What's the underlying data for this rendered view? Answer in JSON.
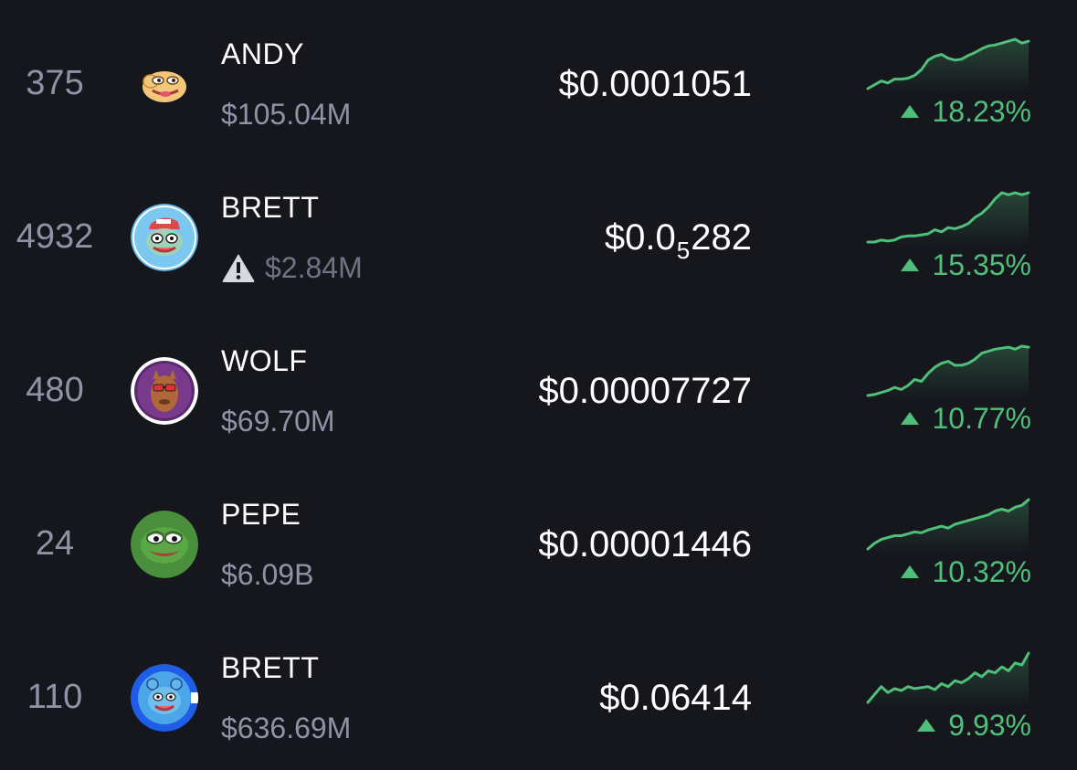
{
  "colors": {
    "background": "#16171d",
    "text_primary": "#ffffff",
    "text_secondary": "#8f93a6",
    "positive": "#4fbf7a"
  },
  "tokens": [
    {
      "rank": "375",
      "name": "ANDY",
      "market_cap": "$105.04M",
      "warning": false,
      "price_parts": [
        "$0.0001051"
      ],
      "change": "18.23%",
      "sparkline": [
        10,
        14,
        18,
        16,
        20,
        20,
        21,
        24,
        30,
        40,
        44,
        46,
        42,
        40,
        41,
        45,
        48,
        52,
        55,
        56,
        58,
        60,
        62,
        58,
        60
      ],
      "change_icon": "up-triangle-icon",
      "avatar_icon": "andy-token-icon"
    },
    {
      "rank": "4932",
      "name": "BRETT",
      "market_cap": "$2.84M",
      "warning": true,
      "warning_icon": "warning-triangle-icon",
      "price_parts": [
        "$0.0",
        "5",
        "282"
      ],
      "change": "15.35%",
      "sparkline": [
        10,
        10,
        12,
        11,
        12,
        15,
        16,
        16,
        17,
        18,
        22,
        20,
        24,
        23,
        25,
        28,
        34,
        38,
        44,
        52,
        58,
        56,
        58,
        56,
        58
      ],
      "change_icon": "up-triangle-icon",
      "avatar_icon": "brett-token-icon"
    },
    {
      "rank": "480",
      "name": "WOLF",
      "market_cap": "$69.70M",
      "warning": false,
      "price_parts": [
        "$0.00007727"
      ],
      "change": "10.77%",
      "sparkline": [
        8,
        9,
        11,
        13,
        16,
        14,
        18,
        24,
        22,
        30,
        36,
        40,
        42,
        38,
        38,
        40,
        44,
        50,
        52,
        54,
        55,
        56,
        54,
        57,
        56
      ],
      "change_icon": "up-triangle-icon",
      "avatar_icon": "wolf-token-icon"
    },
    {
      "rank": "24",
      "name": "PEPE",
      "market_cap": "$6.09B",
      "warning": false,
      "price_parts": [
        "$0.00001446"
      ],
      "change": "10.32%",
      "sparkline": [
        8,
        14,
        18,
        20,
        22,
        22,
        24,
        26,
        25,
        28,
        30,
        32,
        30,
        34,
        36,
        38,
        40,
        42,
        44,
        48,
        50,
        48,
        52,
        54,
        60
      ],
      "change_icon": "up-triangle-icon",
      "avatar_icon": "pepe-token-icon"
    },
    {
      "rank": "110",
      "name": "BRETT",
      "market_cap": "$636.69M",
      "warning": false,
      "price_parts": [
        "$0.06414"
      ],
      "change": "9.93%",
      "sparkline": [
        14,
        22,
        30,
        24,
        28,
        26,
        30,
        28,
        29,
        30,
        27,
        33,
        30,
        36,
        34,
        38,
        44,
        40,
        46,
        44,
        50,
        46,
        54,
        52,
        64
      ],
      "change_icon": "up-triangle-icon",
      "avatar_icon": "brett-base-token-icon"
    }
  ]
}
